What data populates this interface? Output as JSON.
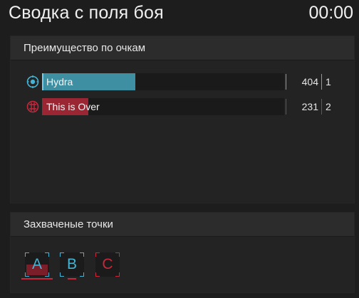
{
  "header": {
    "title": "Сводка с поля боя",
    "timer": "00:00"
  },
  "score_panel": {
    "title": "Преимущество по очкам",
    "teams": [
      {
        "name": "Hydra",
        "score": "404",
        "rank": "1",
        "progress": 0.38,
        "color": "#3f8fa2",
        "accent": "#45b4d4",
        "icon": "hydra-emblem-icon"
      },
      {
        "name": "This is Over",
        "score": "231",
        "rank": "2",
        "progress": 0.19,
        "color": "#9a2633",
        "accent": "#c8283c",
        "icon": "over-emblem-icon"
      }
    ]
  },
  "capture_panel": {
    "title": "Захваченые точки",
    "points": [
      {
        "label": "A",
        "owner": "Hydra"
      },
      {
        "label": "B",
        "owner": "Hydra"
      },
      {
        "label": "C",
        "owner": "This is Over"
      }
    ]
  }
}
